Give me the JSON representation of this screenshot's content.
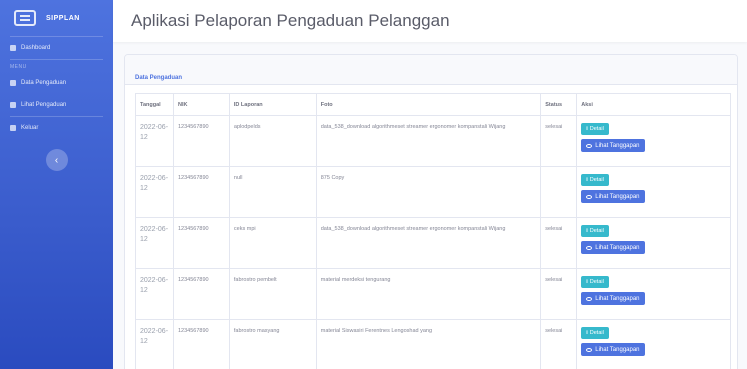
{
  "app": {
    "brand": "SIPPLAN",
    "title": "Aplikasi Pelaporan Pengaduan Pelanggan"
  },
  "sidebar": {
    "items": [
      {
        "label": "Dashboard",
        "icon": "dashboard-icon"
      },
      {
        "label": "Data Pengaduan",
        "icon": "table-icon"
      },
      {
        "label": "Lihat Pengaduan",
        "icon": "list-icon"
      },
      {
        "label": "Keluar",
        "icon": "logout-icon"
      }
    ],
    "heading": "Menu",
    "toggle_icon": "chevron-left-icon"
  },
  "card": {
    "title": "Data Pengaduan"
  },
  "table": {
    "headers": [
      "Tanggal",
      "NIK",
      "ID Laporan",
      "Foto",
      "Status",
      "Aksi"
    ],
    "rows": [
      {
        "tanggal": "2022-06-12",
        "nik": "1234567890",
        "id": "aplodpelds",
        "isi": "data_538_download algorithmeset streamer ergonomer kompanstali Wijang",
        "status": "selesai"
      },
      {
        "tanggal": "2022-06-12",
        "nik": "1234567890",
        "id": "null",
        "isi": "875 Copy",
        "status": ""
      },
      {
        "tanggal": "2022-06-12",
        "nik": "1234567890",
        "id": "ceks mpi",
        "isi": "data_538_download algorithmeset streamer ergonomer kompanstali Wijang",
        "status": "selesai"
      },
      {
        "tanggal": "2022-06-12",
        "nik": "1234567890",
        "id": "fabrostro pembelt",
        "isi": "material merdeksi tengurang",
        "status": "selesai"
      },
      {
        "tanggal": "2022-06-12",
        "nik": "1234567890",
        "id": "fabrostro masyang",
        "isi": "material Siswasiri Ferentnes Lengoshad yang",
        "status": "selesai"
      }
    ],
    "actions": {
      "detail": "Detail",
      "tanggapan": "Lihat Tanggapan"
    }
  },
  "colors": {
    "sidebar": "#4e73df",
    "detail_button": "#36b9cc",
    "tanggapan_button": "#4e73df"
  }
}
